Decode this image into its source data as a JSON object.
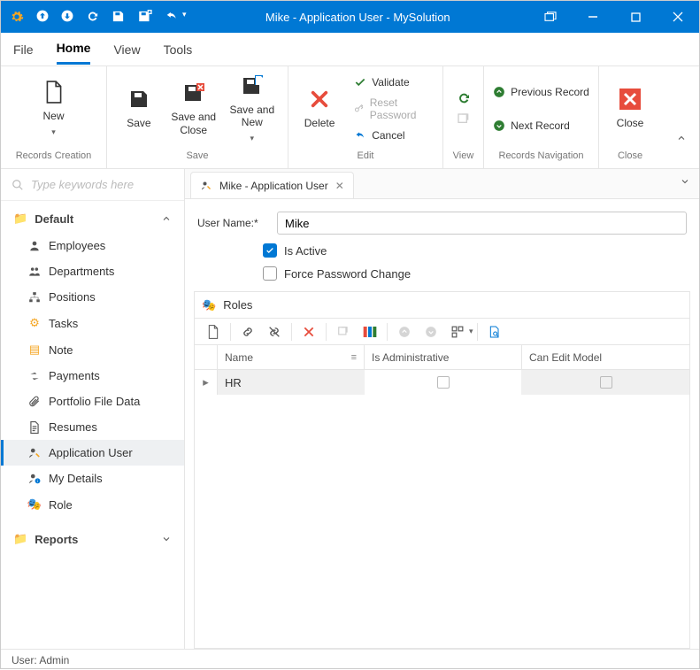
{
  "title": "Mike - Application User - MySolution",
  "menuTabs": {
    "file": "File",
    "home": "Home",
    "view": "View",
    "tools": "Tools"
  },
  "ribbon": {
    "records": {
      "new": "New",
      "group": "Records Creation"
    },
    "save": {
      "save": "Save",
      "saveClose": "Save and Close",
      "saveNew": "Save and New",
      "group": "Save"
    },
    "edit": {
      "delete": "Delete",
      "validate": "Validate",
      "reset": "Reset Password",
      "cancel": "Cancel",
      "group": "Edit"
    },
    "view": {
      "group": "View"
    },
    "nav": {
      "prev": "Previous Record",
      "next": "Next Record",
      "group": "Records Navigation"
    },
    "close": {
      "close": "Close",
      "group": "Close"
    }
  },
  "search": {
    "placeholder": "Type keywords here"
  },
  "navGroups": {
    "default": "Default",
    "reports": "Reports"
  },
  "navItems": {
    "employees": "Employees",
    "departments": "Departments",
    "positions": "Positions",
    "tasks": "Tasks",
    "note": "Note",
    "payments": "Payments",
    "portfolio": "Portfolio File Data",
    "resumes": "Resumes",
    "appUser": "Application User",
    "myDetails": "My Details",
    "role": "Role"
  },
  "docTab": {
    "title": "Mike - Application User"
  },
  "form": {
    "userNameLabel": "User Name:*",
    "userName": "Mike",
    "isActive": "Is Active",
    "forcePw": "Force Password Change"
  },
  "roles": {
    "title": "Roles",
    "cols": {
      "name": "Name",
      "admin": "Is Administrative",
      "edit": "Can Edit Model"
    },
    "rows": [
      {
        "name": "HR",
        "admin": false,
        "edit": false
      }
    ]
  },
  "statusbar": {
    "user": "User: Admin"
  }
}
